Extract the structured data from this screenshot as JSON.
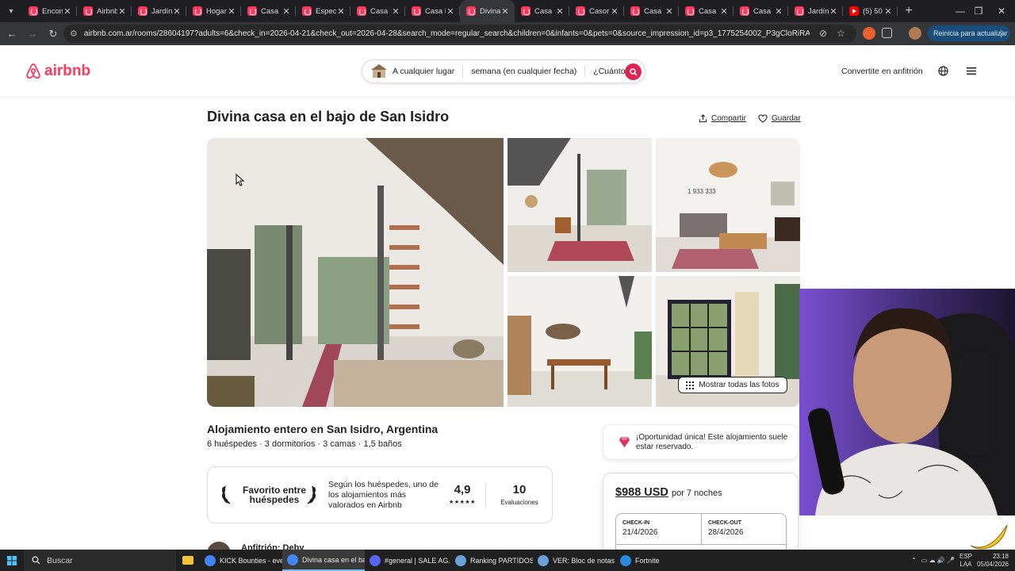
{
  "browser": {
    "tabs": [
      {
        "title": "Encon",
        "type": "airbnb"
      },
      {
        "title": "Airbnb",
        "type": "airbnb"
      },
      {
        "title": "Jardín",
        "type": "airbnb"
      },
      {
        "title": "Hogar",
        "type": "airbnb"
      },
      {
        "title": "Casa",
        "type": "airbnb"
      },
      {
        "title": "Espec",
        "type": "airbnb"
      },
      {
        "title": "Casa",
        "type": "airbnb"
      },
      {
        "title": "Casa l",
        "type": "airbnb"
      },
      {
        "title": "Divina",
        "type": "airbnb",
        "active": true
      },
      {
        "title": "Casa",
        "type": "airbnb"
      },
      {
        "title": "Casor",
        "type": "airbnb"
      },
      {
        "title": "Casa",
        "type": "airbnb"
      },
      {
        "title": "Casa",
        "type": "airbnb"
      },
      {
        "title": "Casa",
        "type": "airbnb"
      },
      {
        "title": "Jardín",
        "type": "airbnb"
      },
      {
        "title": "(5) 50",
        "type": "youtube"
      }
    ],
    "new_tab_icon": "plus-icon",
    "url": "airbnb.com.ar/rooms/28604197?adults=6&check_in=2026-04-21&check_out=2026-04-28&search_mode=regular_search&children=0&infants=0&pets=0&source_impression_id=p3_1775254002_P3gCloRiRA75pvN&previ...",
    "update_button": "Reinicia para actualizar"
  },
  "airbnb": {
    "logo_text": "airbnb",
    "search": {
      "where": "A cualquier lugar",
      "when": "semana (en cualquier fecha)",
      "who": "¿Cuántos?"
    },
    "host_link": "Convertite en anfitrión",
    "accent": "#ff385c"
  },
  "listing": {
    "title": "Divina casa en el bajo de San Isidro",
    "share": "Compartir",
    "save": "Guardar",
    "show_all_photos": "Mostrar todas las fotos",
    "subtitle": "Alojamiento entero en San Isidro, Argentina",
    "specs": "6 huéspedes · 3 dormitorios · 3 camas · 1,5 baños",
    "guest_favorite": {
      "title": "Favorito entre huéspedes",
      "description": "Según los huéspedes, uno de los alojamientos más valorados en Airbnb",
      "rating": "4,9",
      "stars": "★★★★★",
      "reviews_count": "10",
      "reviews_label": "Evaluaciones"
    },
    "host": "Anfitrión: Deby",
    "rare_find": "¡Oportunidad única! Este alojamiento suele estar reservado.",
    "booking": {
      "price": "$988 USD",
      "nights": "por 7 noches",
      "checkin_label": "CHECK-IN",
      "checkin": "21/4/2026",
      "checkout_label": "CHECK-OUT",
      "checkout": "28/4/2026"
    }
  },
  "taskbar": {
    "search": "Buscar",
    "items": [
      {
        "label": "KICK Bounties - eve...",
        "icon": "chrome",
        "active": false
      },
      {
        "label": "Divina casa en el ba...",
        "icon": "chrome",
        "active": true
      },
      {
        "label": "#general | SALE AG...",
        "icon": "discord",
        "active": false
      },
      {
        "label": "Ranking PARTIDOS ...",
        "icon": "notepad",
        "active": false
      },
      {
        "label": "VER: Bloc de notas",
        "icon": "notepad",
        "active": false
      },
      {
        "label": "Fortnite",
        "icon": "fortnite",
        "active": false
      }
    ],
    "lang": "ESP",
    "lang2": "LAA",
    "time": "23:18",
    "date": "05/04/2026"
  }
}
